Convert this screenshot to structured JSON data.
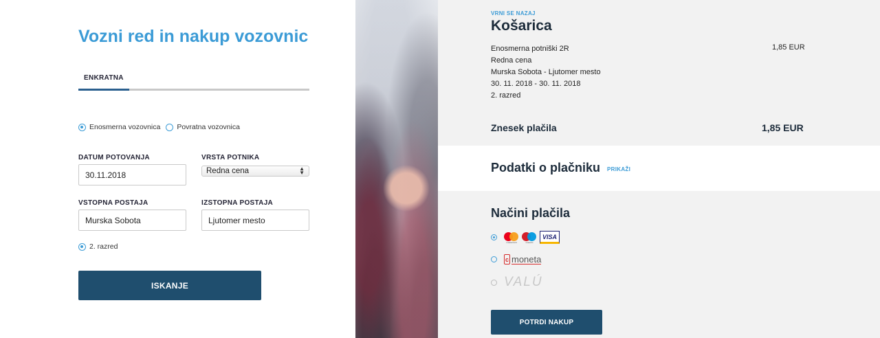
{
  "left": {
    "title": "Vozni red in nakup vozovnic",
    "tab_label": "ENKRATNA",
    "ticket_type": {
      "one_way_label": "Enosmerna vozovnica",
      "return_label": "Povratna vozovnica",
      "selected": "one_way"
    },
    "date_label": "DATUM POTOVANJA",
    "date_value": "30.11.2018",
    "passenger_label": "VRSTA POTNIKA",
    "passenger_value": "Redna cena",
    "from_label": "VSTOPNA POSTAJA",
    "from_value": "Murska Sobota",
    "to_label": "IZSTOPNA POSTAJA",
    "to_value": "Ljutomer mesto",
    "class_label": "2. razred",
    "search_button": "ISKANJE"
  },
  "right": {
    "back_link": "VRNI SE NAZAJ",
    "cart_title": "Košarica",
    "cart_item": {
      "name": "Enosmerna potniški 2R",
      "fare": "Redna cena",
      "route": "Murska Sobota - Ljutomer mesto",
      "dates": "30. 11. 2018 - 30. 11. 2018",
      "class": "2. razred",
      "price": "1,85 EUR"
    },
    "total_label": "Znesek plačila",
    "total_value": "1,85 EUR",
    "payer_title": "Podatki o plačniku",
    "payer_link": "PRIKAŽI",
    "payment_title": "Načini plačila",
    "payment_methods": {
      "cards_visa": "VISA",
      "mastercard_caption": "mastercard",
      "maestro_caption": "maestro",
      "moneta": "moneta",
      "moneta_icon_letter": "c",
      "valu": "VALÚ",
      "selected": "cards"
    },
    "confirm_button": "POTRDI NAKUP"
  },
  "colors": {
    "accent_blue": "#3b9bd6",
    "button_navy": "#1f4e6e",
    "panel_grey": "#f2f2f2"
  }
}
